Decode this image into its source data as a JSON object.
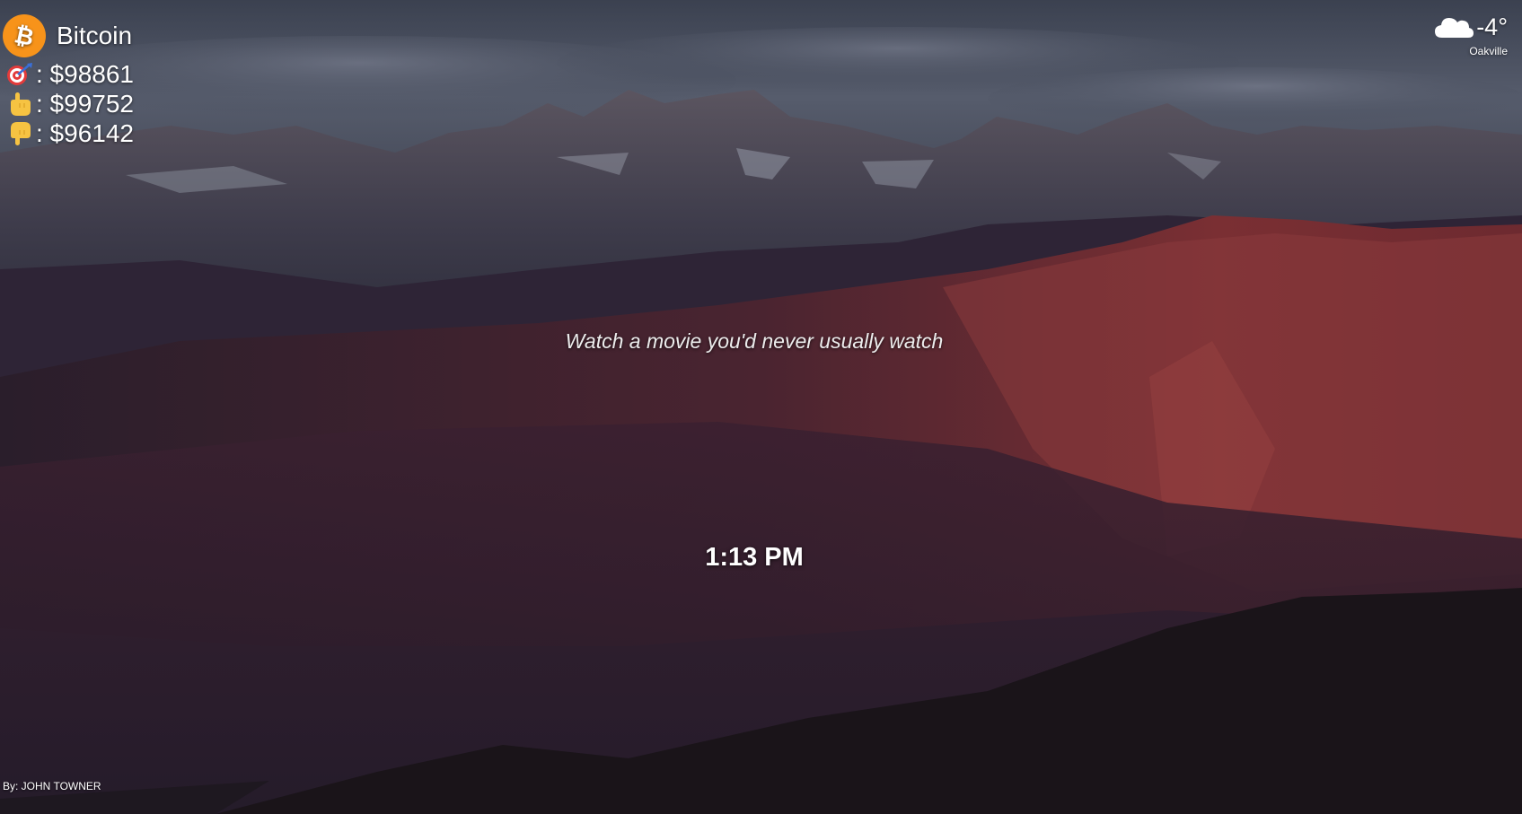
{
  "crypto": {
    "name": "Bitcoin",
    "logo_icon": "bitcoin-logo-icon",
    "logo_color": "#F7931A",
    "prices": [
      {
        "icon": "target-icon",
        "label": ": $98861"
      },
      {
        "icon": "pointing-up-icon",
        "label": ": $99752"
      },
      {
        "icon": "pointing-down-icon",
        "label": ": $96142"
      }
    ]
  },
  "weather": {
    "icon": "cloud-icon",
    "temperature": "-4°",
    "location": "Oakville"
  },
  "quote": "Watch a movie you'd never usually watch",
  "clock": "1:13 PM",
  "photo_credit": "By: JOHN TOWNER"
}
